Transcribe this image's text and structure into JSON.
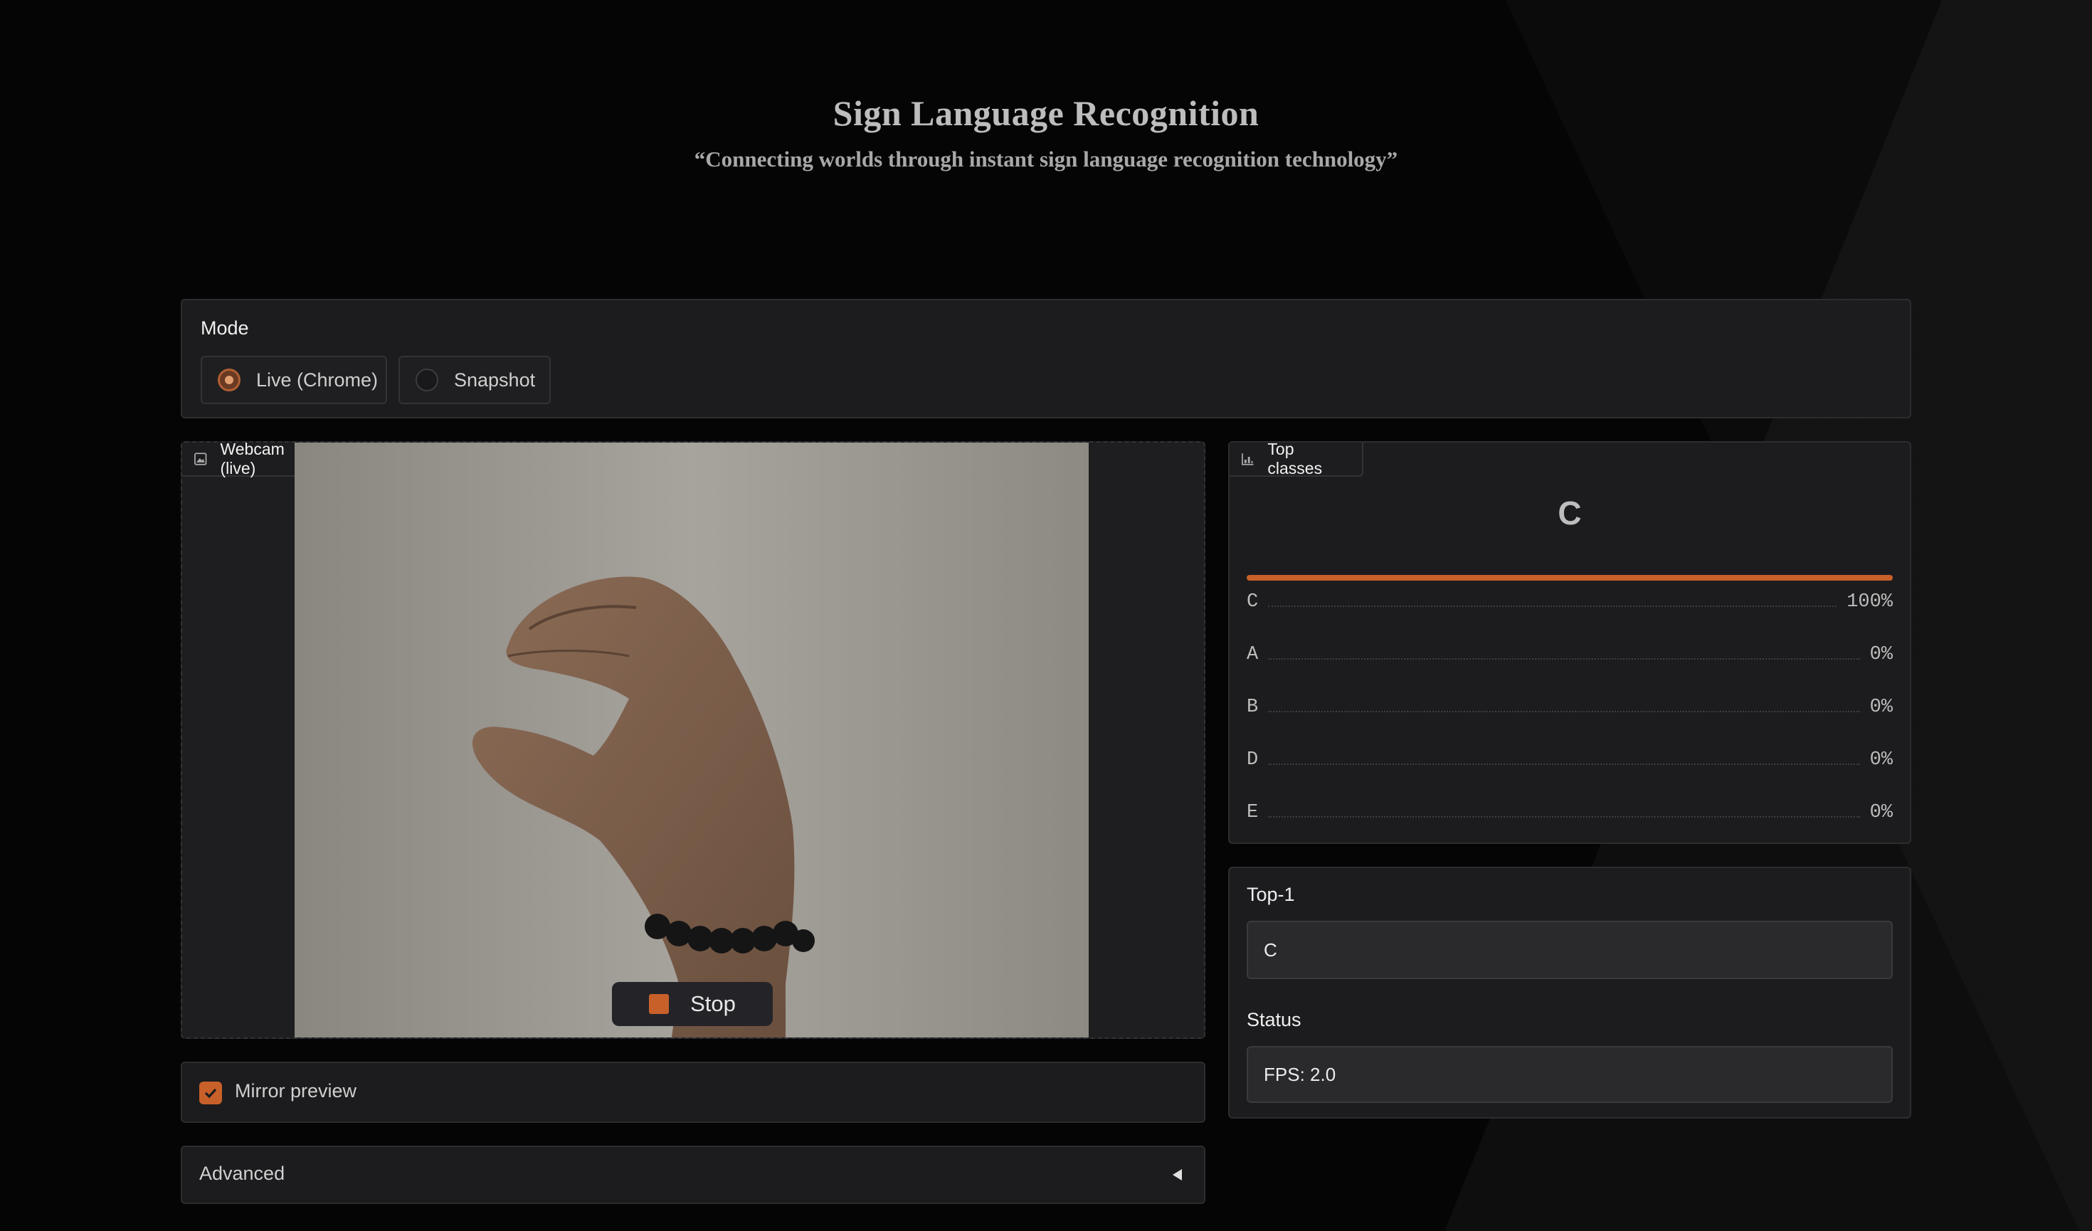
{
  "header": {
    "title": "Sign Language Recognition",
    "subtitle": "“Connecting worlds through instant sign language recognition technology”"
  },
  "mode": {
    "label": "Mode",
    "options": [
      {
        "label": "Live (Chrome)",
        "selected": true
      },
      {
        "label": "Snapshot",
        "selected": false
      }
    ]
  },
  "webcam": {
    "tag": "Webcam (live)",
    "icon": "image-icon",
    "stop_label": "Stop"
  },
  "mirror": {
    "label": "Mirror preview",
    "checked": true
  },
  "advanced": {
    "label": "Advanced",
    "icon": "triangle-left-icon"
  },
  "top_classes": {
    "tag": "Top classes",
    "icon": "bar-chart-icon",
    "top_label": "C",
    "bar_fill": 1.0,
    "rows": [
      {
        "label": "C",
        "value": "100%"
      },
      {
        "label": "A",
        "value": "0%"
      },
      {
        "label": "B",
        "value": "0%"
      },
      {
        "label": "D",
        "value": "0%"
      },
      {
        "label": "E",
        "value": "0%"
      }
    ]
  },
  "top1": {
    "label": "Top-1",
    "value": "C"
  },
  "status": {
    "label": "Status",
    "value": "FPS: 2.0"
  },
  "colors": {
    "accent": "#c8602a",
    "panel": "#1c1c1e",
    "background": "#050505"
  }
}
